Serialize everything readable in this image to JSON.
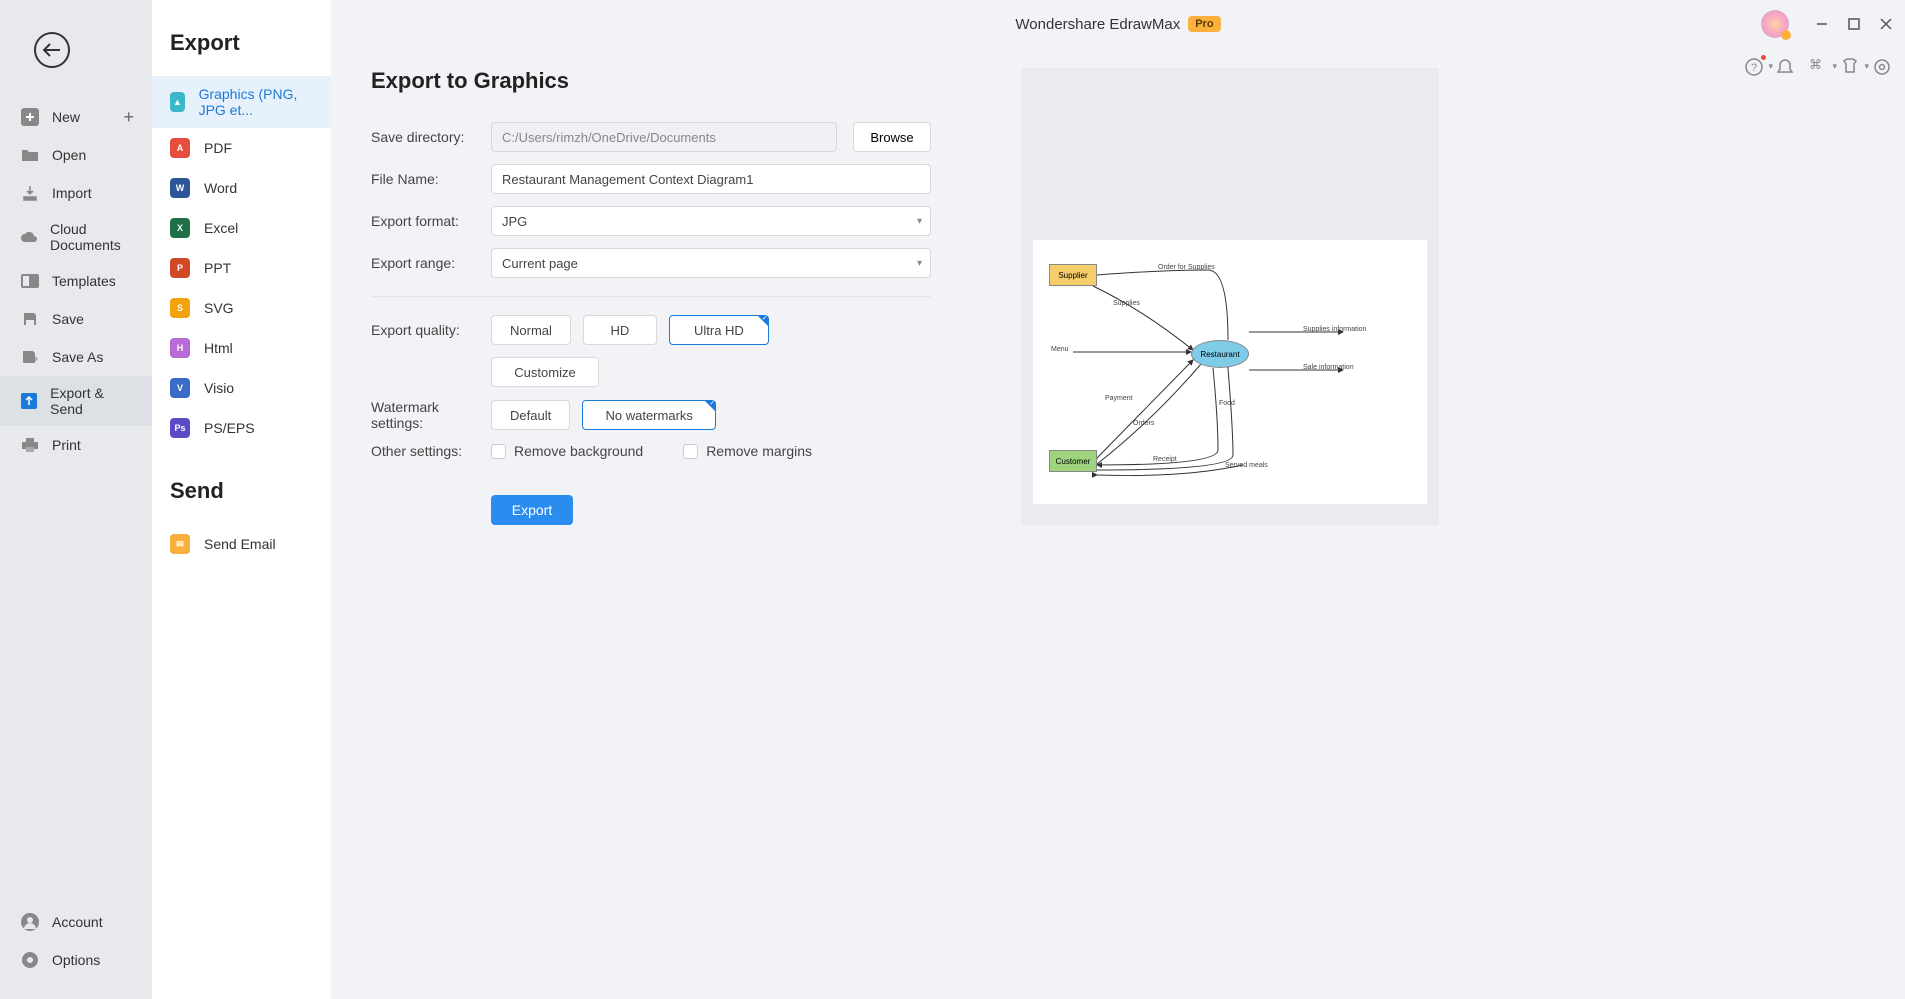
{
  "app": {
    "title": "Wondershare EdrawMax",
    "badge": "Pro"
  },
  "sidebar": {
    "items": [
      "New",
      "Open",
      "Import",
      "Cloud Documents",
      "Templates",
      "Save",
      "Save As",
      "Export & Send",
      "Print"
    ],
    "bottom": [
      "Account",
      "Options"
    ]
  },
  "formats": {
    "export_title": "Export",
    "send_title": "Send",
    "items": [
      "Graphics (PNG, JPG et...",
      "PDF",
      "Word",
      "Excel",
      "PPT",
      "SVG",
      "Html",
      "Visio",
      "PS/EPS"
    ],
    "send_items": [
      "Send Email"
    ]
  },
  "main": {
    "page_title": "Export to Graphics",
    "labels": {
      "save_dir": "Save directory:",
      "file_name": "File Name:",
      "format": "Export format:",
      "range": "Export range:",
      "quality": "Export quality:",
      "watermark": "Watermark settings:",
      "other": "Other settings:"
    },
    "values": {
      "save_dir": "C:/Users/rimzh/OneDrive/Documents",
      "file_name": "Restaurant Management Context Diagram1",
      "format": "JPG",
      "range": "Current page"
    },
    "browse": "Browse",
    "quality": {
      "normal": "Normal",
      "hd": "HD",
      "ultra": "Ultra HD",
      "customize": "Customize"
    },
    "watermark": {
      "default": "Default",
      "none": "No watermarks"
    },
    "checkboxes": {
      "remove_bg": "Remove background",
      "remove_margins": "Remove margins"
    },
    "export_btn": "Export"
  },
  "diagram": {
    "supplier": "Supplier",
    "restaurant": "Restaurant",
    "customer": "Customer",
    "menu": "Menu",
    "order_supplies": "Order for Supplies",
    "supplies": "Supplies",
    "supplies_info": "Supplies information",
    "sale_info": "Sale information",
    "payment": "Payment",
    "orders": "Orders",
    "food": "Food",
    "receipt": "Receipt",
    "served_meals": "Served meals"
  }
}
